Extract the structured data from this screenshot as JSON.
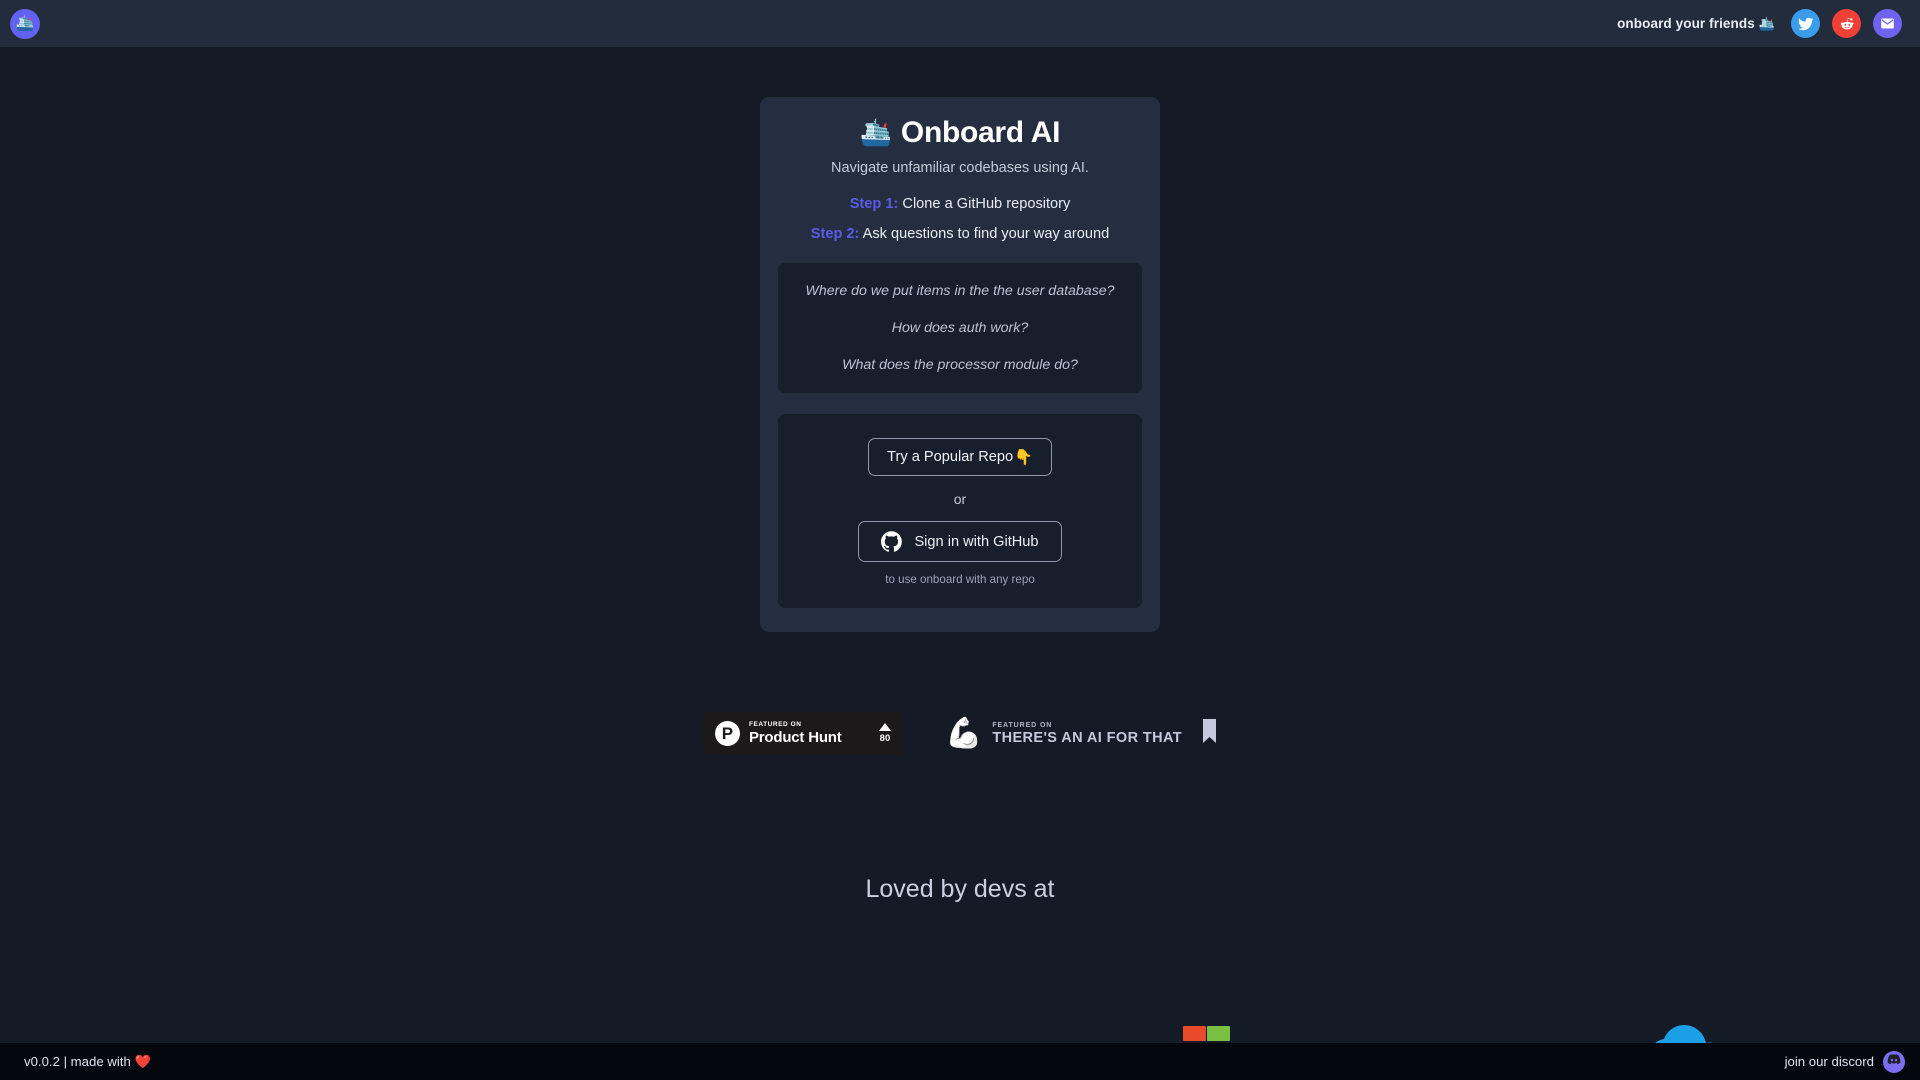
{
  "topbar": {
    "brand_icon": "ship-emoji",
    "brand_emoji": "🛳️",
    "share_label": "onboard your friends",
    "share_emoji": "🛳️",
    "socials": [
      {
        "name": "twitter",
        "color": "#3b9ceb"
      },
      {
        "name": "reddit",
        "color": "#ef4136"
      },
      {
        "name": "email",
        "color": "#6f62ef"
      }
    ]
  },
  "card": {
    "title": "Onboard AI",
    "title_emoji": "🛳️",
    "subtitle": "Navigate unfamiliar codebases using AI.",
    "steps": [
      {
        "key": "Step 1:",
        "text": " Clone a GitHub repository"
      },
      {
        "key": "Step 2:",
        "text": " Ask questions to find your way around"
      }
    ],
    "step_key_color": "#5b5ce6",
    "questions": [
      "Where do we put items in the the user database?",
      "How does auth work?",
      "What does the processor module do?"
    ],
    "actions": {
      "popular_repo_label": "Try a Popular Repo",
      "popular_repo_emoji": "👇",
      "or_label": "or",
      "github_label": "Sign in with GitHub",
      "github_icon": "github-icon",
      "hint": "to use onboard with any repo"
    }
  },
  "badges": {
    "product_hunt": {
      "featured_on": "FEATURED ON",
      "name": "Product Hunt",
      "logo_letter": "P",
      "upvotes": "80"
    },
    "theres_an_ai_for_that": {
      "featured_on": "FEATURED ON",
      "name": "THERE'S AN AI FOR THAT",
      "arm_emoji": "💪",
      "bookmark_icon": "bookmark-icon"
    }
  },
  "loved": {
    "heading": "Loved by devs at",
    "logos": [
      {
        "name": "red-green-squares-logo",
        "colors": [
          "#ea4a2c",
          "#7ac143"
        ]
      },
      {
        "name": "cloud-logo",
        "colors": [
          "#00a0e9"
        ]
      }
    ]
  },
  "footer": {
    "version_text": "v0.0.2 | made with ❤️",
    "discord_label": "join our discord",
    "discord_icon": "discord-icon"
  }
}
